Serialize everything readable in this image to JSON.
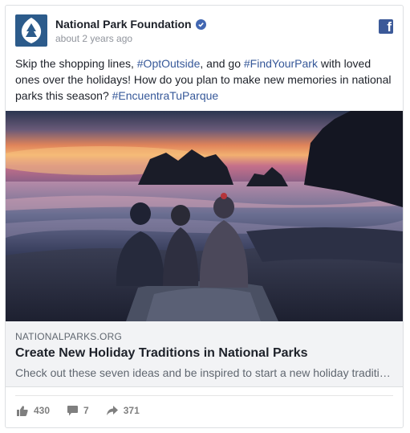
{
  "post": {
    "page_name": "National Park Foundation",
    "timestamp": "about 2 years ago",
    "text_parts": [
      "Skip the shopping lines, ",
      "#OptOutside",
      ", and go ",
      "#FindYourPark",
      " with loved ones over the holidays! How do you plan to make new memories in national parks this season? ",
      "#EncuentraTuParque"
    ]
  },
  "link": {
    "domain": "NATIONALPARKS.ORG",
    "title": "Create New Holiday Traditions in National Parks",
    "description": "Check out these seven ideas and be inspired to start a new holiday traditions"
  },
  "stats": {
    "likes": "430",
    "comments": "7",
    "shares": "371"
  },
  "colors": {
    "link_blue": "#365899",
    "facebook_blue": "#3b5998",
    "verified_blue": "#4267b2",
    "avatar_bg": "#2c5b8b"
  },
  "icons": [
    "arrowhead-logo-icon",
    "verified-badge-icon",
    "facebook-icon",
    "like-icon",
    "comment-icon",
    "share-icon"
  ]
}
